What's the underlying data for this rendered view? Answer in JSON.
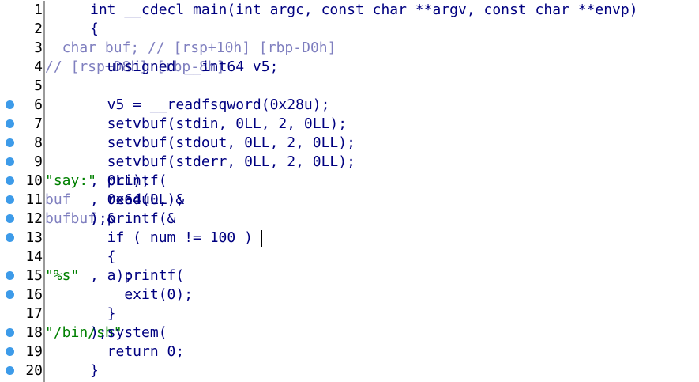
{
  "colors": {
    "code_text": "#000080",
    "string_literal": "#008000",
    "comment_and_stack_var": "#7f7fbf",
    "line_number": "#000000",
    "breakpoint_dot": "#3d9be9",
    "background": "#ffffff"
  },
  "lines": [
    {
      "no": "1",
      "bp": false,
      "segs": [
        {
          "t": "int __cdecl main(int argc, const char **argv, const char **envp)",
          "c": "code"
        }
      ]
    },
    {
      "no": "2",
      "bp": false,
      "segs": [
        {
          "t": "{",
          "c": "code"
        }
      ]
    },
    {
      "no": "3",
      "bp": false,
      "segs": [
        {
          "t": "  char buf; // [rsp+10h] [rbp-D0h]",
          "c": "comment"
        }
      ]
    },
    {
      "no": "4",
      "bp": false,
      "segs": [
        {
          "t": "  unsigned __int64 v5; ",
          "c": "code"
        },
        {
          "t": "// [rsp+D8h] [rbp-8h]",
          "c": "comment"
        }
      ]
    },
    {
      "no": "5",
      "bp": false,
      "segs": [
        {
          "t": "",
          "c": "code"
        }
      ]
    },
    {
      "no": "6",
      "bp": true,
      "segs": [
        {
          "t": "  v5 = __readfsqword(0x28u);",
          "c": "code"
        }
      ]
    },
    {
      "no": "7",
      "bp": true,
      "segs": [
        {
          "t": "  setvbuf(stdin, 0LL, 2, 0LL);",
          "c": "code"
        }
      ]
    },
    {
      "no": "8",
      "bp": true,
      "segs": [
        {
          "t": "  setvbuf(stdout, 0LL, 2, 0LL);",
          "c": "code"
        }
      ]
    },
    {
      "no": "9",
      "bp": true,
      "segs": [
        {
          "t": "  setvbuf(stderr, 0LL, 2, 0LL);",
          "c": "code"
        }
      ]
    },
    {
      "no": "10",
      "bp": true,
      "segs": [
        {
          "t": "  printf(",
          "c": "code"
        },
        {
          "t": "\"say:\"",
          "c": "str"
        },
        {
          "t": ", 0LL);",
          "c": "code"
        }
      ]
    },
    {
      "no": "11",
      "bp": true,
      "segs": [
        {
          "t": "  read(0, &",
          "c": "code"
        },
        {
          "t": "buf",
          "c": "var"
        },
        {
          "t": ", 0x64uLL);",
          "c": "code"
        }
      ]
    },
    {
      "no": "12",
      "bp": true,
      "segs": [
        {
          "t": "  printf(&",
          "c": "code"
        },
        {
          "t": "buf",
          "c": "var"
        },
        {
          "t": ", &",
          "c": "code"
        },
        {
          "t": "buf",
          "c": "var"
        },
        {
          "t": ");",
          "c": "code"
        }
      ]
    },
    {
      "no": "13",
      "bp": true,
      "segs": [
        {
          "t": "  if ( num != 100 )",
          "c": "code"
        }
      ]
    },
    {
      "no": "14",
      "bp": false,
      "segs": [
        {
          "t": "  {",
          "c": "code"
        }
      ]
    },
    {
      "no": "15",
      "bp": true,
      "segs": [
        {
          "t": "    printf(",
          "c": "code"
        },
        {
          "t": "\"%s\"",
          "c": "str"
        },
        {
          "t": ", a);",
          "c": "code"
        }
      ]
    },
    {
      "no": "16",
      "bp": true,
      "segs": [
        {
          "t": "    exit(0);",
          "c": "code"
        }
      ]
    },
    {
      "no": "17",
      "bp": false,
      "segs": [
        {
          "t": "  }",
          "c": "code"
        }
      ]
    },
    {
      "no": "18",
      "bp": true,
      "segs": [
        {
          "t": "  system(",
          "c": "code"
        },
        {
          "t": "\"/bin/sh\"",
          "c": "str"
        },
        {
          "t": ");",
          "c": "code"
        }
      ]
    },
    {
      "no": "19",
      "bp": true,
      "segs": [
        {
          "t": "  return 0;",
          "c": "code"
        }
      ]
    },
    {
      "no": "20",
      "bp": true,
      "segs": [
        {
          "t": "}",
          "c": "code"
        }
      ]
    }
  ]
}
